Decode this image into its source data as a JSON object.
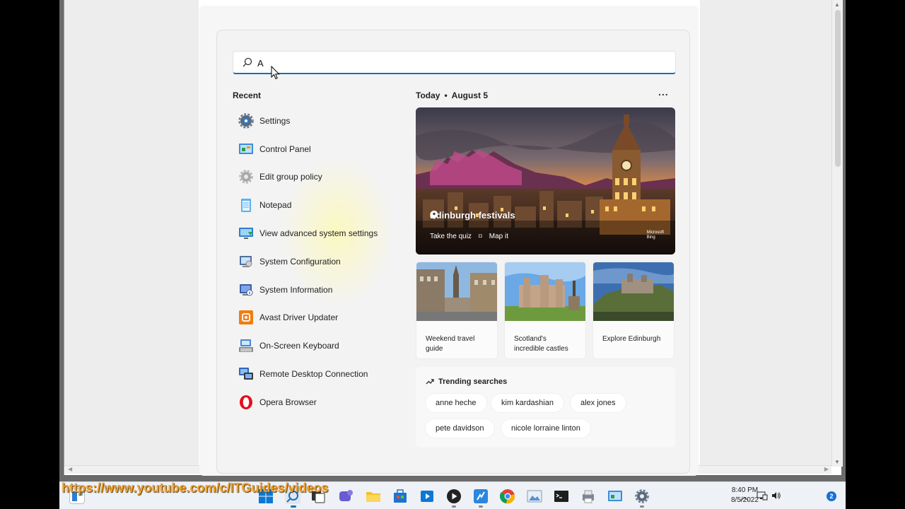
{
  "search": {
    "value": "A",
    "placeholder": ""
  },
  "recent": {
    "heading": "Recent",
    "items": [
      {
        "label": "Settings",
        "icon": "gear-icon"
      },
      {
        "label": "Control Panel",
        "icon": "control-panel-icon"
      },
      {
        "label": "Edit group policy",
        "icon": "group-policy-icon"
      },
      {
        "label": "Notepad",
        "icon": "notepad-icon"
      },
      {
        "label": "View advanced system settings",
        "icon": "system-settings-icon"
      },
      {
        "label": "System Configuration",
        "icon": "system-configuration-icon"
      },
      {
        "label": "System Information",
        "icon": "system-information-icon"
      },
      {
        "label": "Avast Driver Updater",
        "icon": "avast-icon"
      },
      {
        "label": "On-Screen Keyboard",
        "icon": "keyboard-icon"
      },
      {
        "label": "Remote Desktop Connection",
        "icon": "remote-desktop-icon"
      },
      {
        "label": "Opera Browser",
        "icon": "opera-icon"
      }
    ]
  },
  "today": {
    "label": "Today",
    "date": "August 5",
    "more": "..."
  },
  "hero": {
    "title": "Edinburgh festivals",
    "link_quiz": "Take the quiz",
    "link_map": "Map it",
    "brand_line1": "Microsoft",
    "brand_line2": "Bing"
  },
  "cards": [
    {
      "label": "Weekend travel guide"
    },
    {
      "label": "Scotland's incredible castles"
    },
    {
      "label": "Explore Edinburgh"
    }
  ],
  "trending": {
    "heading": "Trending searches",
    "chips": [
      "anne heche",
      "kim kardashian",
      "alex jones",
      "pete davidson",
      "nicole lorraine linton"
    ]
  },
  "watermark": "https://www.youtube.com/c/ITGuides/videos",
  "clock": {
    "time": "8:40 PM",
    "date": "8/5/2022"
  },
  "notifications": {
    "count": "2"
  },
  "colors": {
    "accent": "#1a6fb3",
    "watermark": "#f0a030"
  }
}
